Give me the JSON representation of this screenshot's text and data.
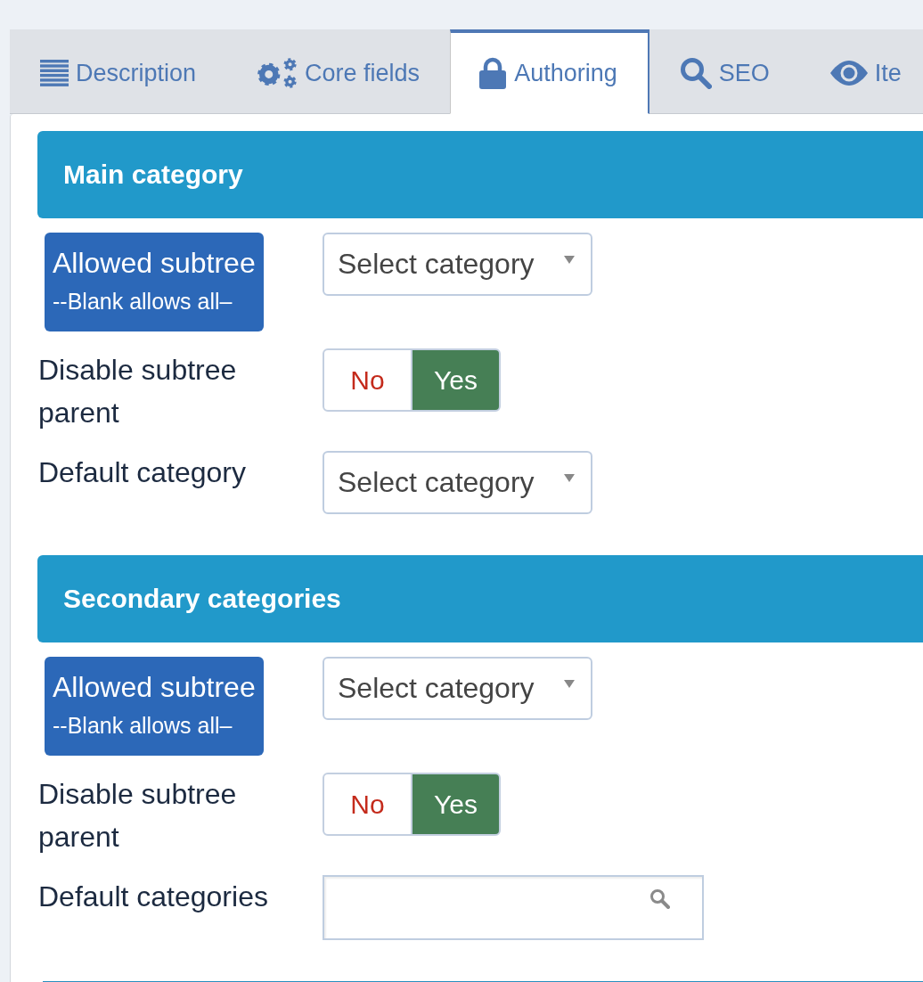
{
  "tabs": [
    {
      "label": "Description",
      "selected": false
    },
    {
      "label": "Core fields",
      "selected": false
    },
    {
      "label": "Authoring",
      "selected": true
    },
    {
      "label": "SEO",
      "selected": false
    },
    {
      "label": "Ite",
      "selected": false
    }
  ],
  "sections": [
    {
      "title": "Main category",
      "fields": [
        {
          "kind": "select",
          "label": "Allowed subtree",
          "note": "--Blank allows all–",
          "highlighted": true,
          "placeholder": "Select category"
        },
        {
          "kind": "toggle",
          "label": "Disable subtree parent",
          "highlighted": false,
          "options": [
            {
              "label": "No",
              "color": "#c42b1c",
              "selected": false
            },
            {
              "label": "Yes",
              "color": "#467f55",
              "selected": true
            }
          ]
        },
        {
          "kind": "select",
          "label": "Default category",
          "highlighted": false,
          "placeholder": "Select category"
        }
      ]
    },
    {
      "title": "Secondary categories",
      "fields": [
        {
          "kind": "select",
          "label": "Allowed subtree",
          "note": "--Blank allows all–",
          "highlighted": true,
          "placeholder": "Select category"
        },
        {
          "kind": "toggle",
          "label": "Disable subtree parent",
          "highlighted": false,
          "options": [
            {
              "label": "No",
              "color": "#c42b1c",
              "selected": false
            },
            {
              "label": "Yes",
              "color": "#467f55",
              "selected": true
            }
          ]
        },
        {
          "kind": "search",
          "label": "Default categories",
          "highlighted": false
        }
      ]
    }
  ]
}
